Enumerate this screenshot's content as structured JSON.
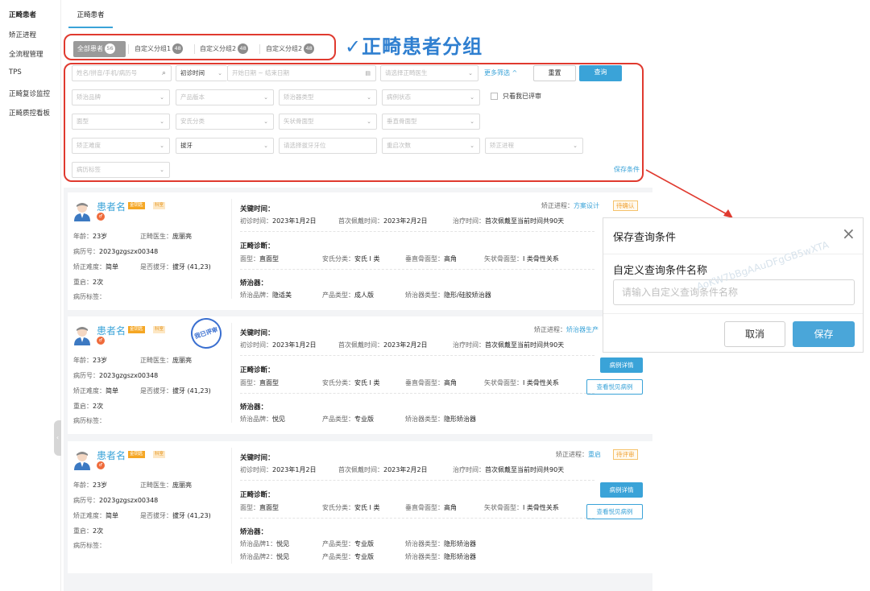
{
  "sidebar": {
    "items": [
      "正畸患者",
      "矫正进程",
      "全流程管理",
      "TPS",
      "正畸复诊监控",
      "正畸质控看板"
    ]
  },
  "header": {
    "tab_title": "正畸患者"
  },
  "groups": {
    "chips": [
      {
        "label": "全部患者",
        "count": "56"
      },
      {
        "label": "自定义分组1",
        "count": "48"
      },
      {
        "label": "自定义分组2",
        "count": "48"
      },
      {
        "label": "自定义分组2",
        "count": "48"
      }
    ],
    "annotation": "✓正畸患者分组"
  },
  "filters": {
    "row1": {
      "search_placeholder": "姓名/拼音/手机/病历号",
      "time_select": "初诊时间",
      "date_range_placeholder": "开始日期 ~ 结束日期",
      "doctor_placeholder": "请选择正畸医生",
      "more": "更多筛选 ^",
      "reset": "重置",
      "query": "查询"
    },
    "row2": [
      "矫治品牌",
      "产品版本",
      "矫治器类型",
      "病例状态"
    ],
    "only_reviewed": "只看我已评审",
    "row3": [
      "面型",
      "安氏分类",
      "矢状骨面型",
      "垂直骨面型"
    ],
    "row4": {
      "difficulty": "矫正难度",
      "extraction": "拔牙",
      "tooth_placeholder": "请选择拔牙牙位",
      "restart": "重启次数",
      "progress": "矫正进程"
    },
    "row5": [
      "病历标签"
    ],
    "save_condition": "保存条件"
  },
  "cards": [
    {
      "name": "患者名",
      "badge1": "金钥匙",
      "badge2": "科室",
      "age_label": "年龄：",
      "age": "23岁",
      "doctor_label": "正畸医生：",
      "doctor": "庞丽亮",
      "record_label": "病历号：",
      "record": "2023gzgszx00348",
      "difficulty_label": "矫正难度：",
      "difficulty": "简单",
      "extraction_label": "是否拔牙：",
      "extraction": "拔牙 (41,23)",
      "restart_label": "重启：",
      "restart": "2次",
      "tags_label": "病历标签：",
      "progress_label": "矫正进程：",
      "progress": "方案设计",
      "status": "待确认",
      "key_time_title": "关键时间：",
      "first_visit_label": "初诊时间：",
      "first_visit": "2023年1月2日",
      "first_wear_label": "首次佩戴时间：",
      "first_wear": "2023年2月2日",
      "treat_time_label": "治疗时间：",
      "treat_time": "首次佩戴至当前时间共90天",
      "diagnosis_title": "正畸诊断：",
      "face_label": "面型：",
      "face": "直面型",
      "angle_label": "安氏分类：",
      "angle": "安氏 I 类",
      "vertical_label": "垂直骨面型：",
      "vertical": "高角",
      "sagittal_label": "矢状骨面型：",
      "sagittal": "I 类骨性关系",
      "appliance_title": "矫治器：",
      "appliances": [
        {
          "brand_label": "矫治品牌：",
          "brand": "隐适美",
          "product_label": "产品类型：",
          "product": "成人版",
          "type_label": "矫治器类型：",
          "type": "隐形/硅胶矫治器"
        }
      ]
    },
    {
      "name": "患者名",
      "badge1": "金钥匙",
      "badge2": "科室",
      "stamp": "我已评审",
      "age_label": "年龄：",
      "age": "23岁",
      "doctor_label": "正畸医生：",
      "doctor": "庞丽亮",
      "record_label": "病历号：",
      "record": "2023gzgszx00348",
      "difficulty_label": "矫正难度：",
      "difficulty": "简单",
      "extraction_label": "是否拔牙：",
      "extraction": "拔牙 (41,23)",
      "restart_label": "重启：",
      "restart": "2次",
      "tags_label": "病历标签：",
      "progress_label": "矫正进程：",
      "progress": "矫治器生产",
      "key_time_title": "关键时间：",
      "first_visit_label": "初诊时间：",
      "first_visit": "2023年1月2日",
      "first_wear_label": "首次佩戴时间：",
      "first_wear": "2023年2月2日",
      "treat_time_label": "治疗时间：",
      "treat_time": "首次佩戴至当前时间共90天",
      "diagnosis_title": "正畸诊断：",
      "face_label": "面型：",
      "face": "直面型",
      "angle_label": "安氏分类：",
      "angle": "安氏 I 类",
      "vertical_label": "垂直骨面型：",
      "vertical": "高角",
      "sagittal_label": "矢状骨面型：",
      "sagittal": "I 类骨性关系",
      "appliance_title": "矫治器：",
      "appliances": [
        {
          "brand_label": "矫治品牌：",
          "brand": "悦见",
          "product_label": "产品类型：",
          "product": "专业版",
          "type_label": "矫治器类型：",
          "type": "隐形矫治器"
        }
      ],
      "btn_detail": "病例详情",
      "btn_view": "查看悦见病例"
    },
    {
      "name": "患者名",
      "badge1": "金钥匙",
      "badge2": "科室",
      "age_label": "年龄：",
      "age": "23岁",
      "doctor_label": "正畸医生：",
      "doctor": "庞丽亮",
      "record_label": "病历号：",
      "record": "2023gzgszx00348",
      "difficulty_label": "矫正难度：",
      "difficulty": "简单",
      "extraction_label": "是否拔牙：",
      "extraction": "拔牙 (41,23)",
      "restart_label": "重启：",
      "restart": "2次",
      "tags_label": "病历标签：",
      "progress_label": "矫正进程：",
      "progress": "重启",
      "status": "待评审",
      "key_time_title": "关键时间：",
      "first_visit_label": "初诊时间：",
      "first_visit": "2023年1月2日",
      "first_wear_label": "首次佩戴时间：",
      "first_wear": "2023年2月2日",
      "treat_time_label": "治疗时间：",
      "treat_time": "首次佩戴至当前时间共90天",
      "diagnosis_title": "正畸诊断：",
      "face_label": "面型：",
      "face": "直面型",
      "angle_label": "安氏分类：",
      "angle": "安氏 I 类",
      "vertical_label": "垂直骨面型：",
      "vertical": "高角",
      "sagittal_label": "矢状骨面型：",
      "sagittal": "I 类骨性关系",
      "appliance_title": "矫治器：",
      "appliances": [
        {
          "brand_label": "矫治品牌1：",
          "brand": "悦见",
          "product_label": "产品类型：",
          "product": "专业版",
          "type_label": "矫治器类型：",
          "type": "隐形矫治器"
        },
        {
          "brand_label": "矫治品牌2：",
          "brand": "悦见",
          "product_label": "产品类型：",
          "product": "专业版",
          "type_label": "矫治器类型：",
          "type": "隐形矫治器"
        }
      ],
      "btn_detail": "病例详情",
      "btn_view": "查看悦见病例"
    }
  ],
  "dialog": {
    "title": "保存查询条件",
    "field_label": "自定义查询条件名称",
    "placeholder": "请输入自定义查询条件名称",
    "watermark": "AoKW7bBgAAuDFgGB5wXTA",
    "cancel": "取消",
    "save": "保存"
  },
  "colors": {
    "accent": "#3aa3d8",
    "annotation_red": "#e03a2f",
    "warning": "#f0a030"
  }
}
